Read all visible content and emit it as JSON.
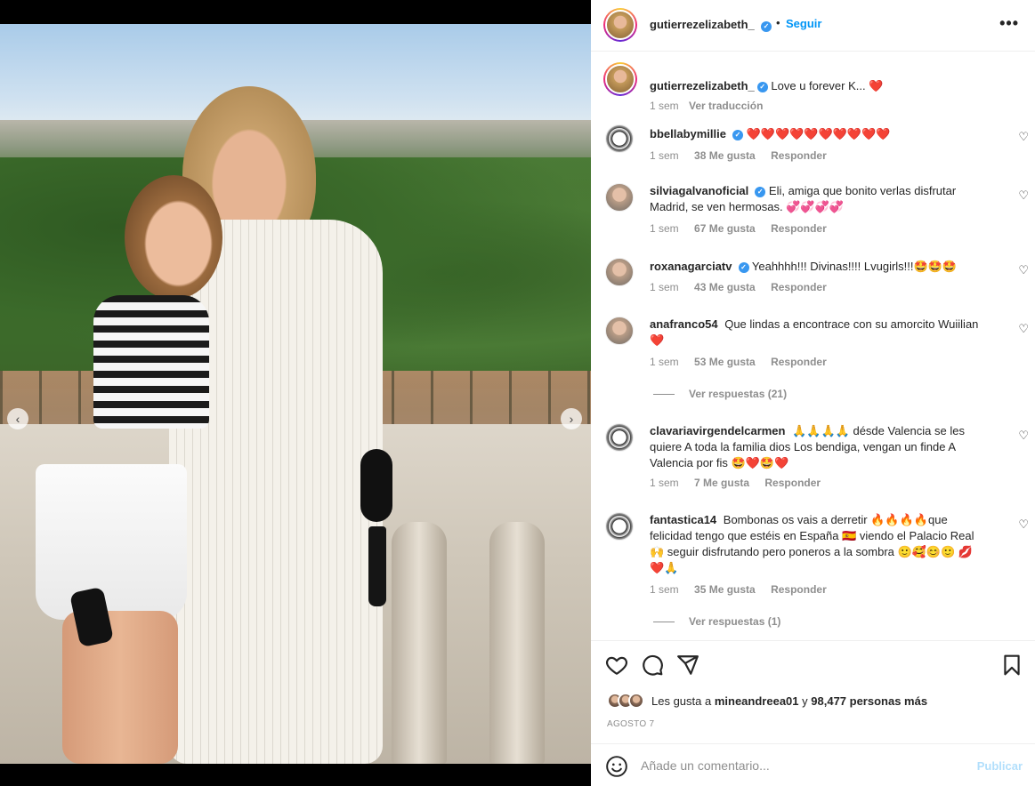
{
  "post": {
    "username": "gutierrezelizabeth_",
    "follow_label": "Seguir",
    "separator": "•",
    "more_label": "•••",
    "caption_text": "Love u forever K... ❤️",
    "caption_time": "1 sem",
    "translate_label": "Ver traducción",
    "carousel_dots": 3,
    "carousel_active_index": 1
  },
  "comments": [
    {
      "username": "bbellabymillie",
      "verified": true,
      "text": "❤️❤️❤️❤️❤️❤️❤️❤️❤️❤️",
      "time": "1 sem",
      "likes": "38 Me gusta",
      "reply": "Responder"
    },
    {
      "username": "silviagalvanoficial",
      "verified": true,
      "text": "Eli, amiga que bonito verlas disfrutar Madrid, se ven hermosas. 💞💞💞💞",
      "time": "1 sem",
      "likes": "67 Me gusta",
      "reply": "Responder"
    },
    {
      "username": "roxanagarciatv",
      "verified": true,
      "text": "Yeahhhh!!! Divinas!!!! Lvugirls!!!🤩🤩🤩",
      "time": "1 sem",
      "likes": "43 Me gusta",
      "reply": "Responder"
    },
    {
      "username": "anafranco54",
      "verified": false,
      "text": "Que lindas a encontrace con su amorcito Wuiilian ❤️",
      "time": "1 sem",
      "likes": "53 Me gusta",
      "reply": "Responder",
      "view_replies": "Ver respuestas (21)"
    },
    {
      "username": "clavariavirgendelcarmen",
      "verified": false,
      "text": "🙏🙏🙏🙏 désde Valencia se les quiere A toda la familia dios Los bendiga, vengan un finde A Valencia por fis 🤩❤️🤩❤️",
      "time": "1 sem",
      "likes": "7 Me gusta",
      "reply": "Responder"
    },
    {
      "username": "fantastica14",
      "verified": false,
      "text": "Bombonas os vais a derretir 🔥🔥🔥🔥que felicidad tengo que estéis en España 🇪🇦 viendo el Palacio Real 🙌 seguir disfrutando pero poneros a la sombra 🙂🥰😊🙂 💋❤️🙏",
      "time": "1 sem",
      "likes": "35 Me gusta",
      "reply": "Responder",
      "view_replies": "Ver respuestas (1)"
    }
  ],
  "engagement": {
    "likes_prefix": "Les gusta a",
    "likes_user": "mineandreea01",
    "likes_joiner": "y",
    "likes_count": "98,477 personas más",
    "date": "AGOSTO 7"
  },
  "comment_box": {
    "placeholder": "Añade un comentario...",
    "publish_label": "Publicar"
  },
  "colors": {
    "accent": "#0095f6",
    "publish_disabled": "#b2dffc",
    "heart": "#ed1c24",
    "verified": "#3897f0"
  },
  "icons": [
    "heart-icon",
    "comment-icon",
    "share-icon",
    "bookmark-icon",
    "smile-icon",
    "verified-icon",
    "chevron-left-icon",
    "chevron-right-icon"
  ]
}
